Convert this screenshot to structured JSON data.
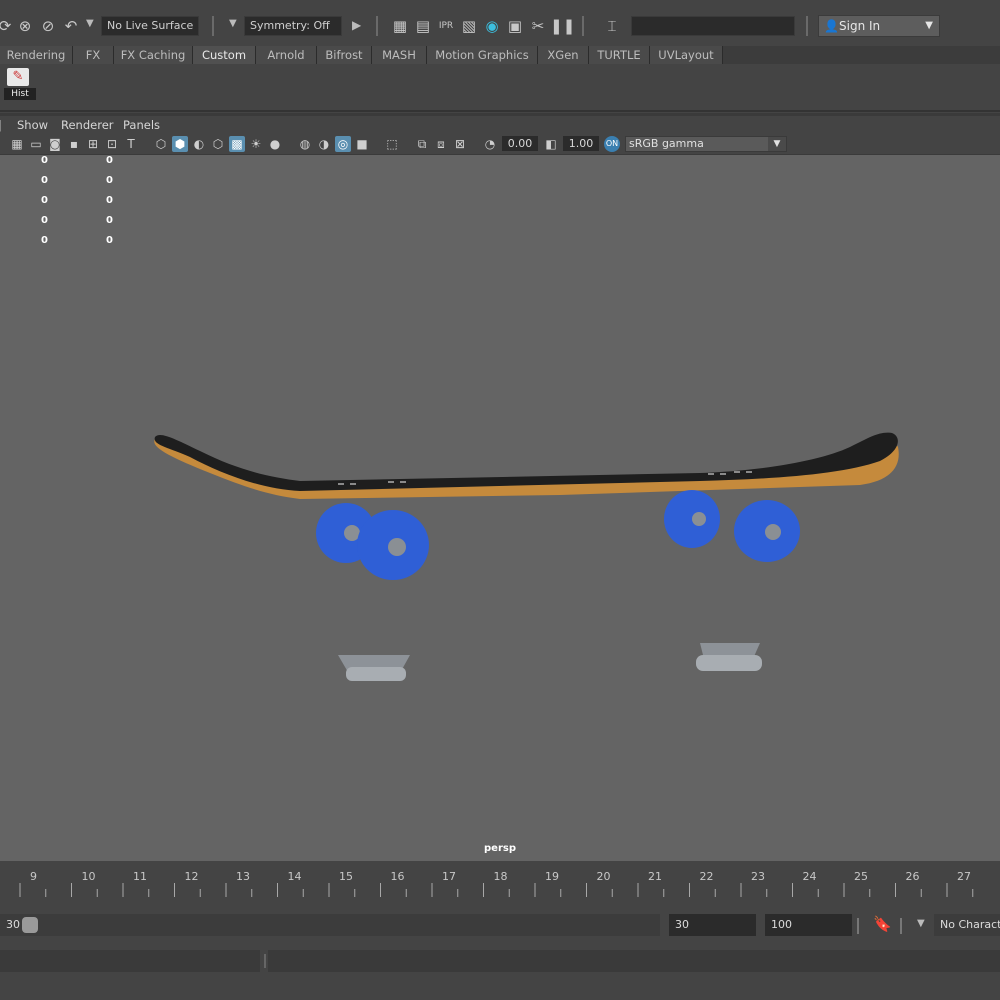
{
  "status_line": {
    "live_surface": "No Live Surface",
    "symmetry": "Symmetry: Off",
    "sign_in": "Sign In",
    "search_value": ""
  },
  "shelf_tabs": [
    "Rendering",
    "FX",
    "FX Caching",
    "Custom",
    "Arnold",
    "Bifrost",
    "MASH",
    "Motion Graphics",
    "XGen",
    "TURTLE",
    "UVLayout"
  ],
  "active_tab": "Custom",
  "shelf": {
    "hist_label": "Hist"
  },
  "panel_menu": [
    "Show",
    "Renderer",
    "Panels"
  ],
  "panel_toolbar": {
    "exposure": "0.00",
    "gamma": "1.00",
    "colorspace": "sRGB gamma"
  },
  "hud": {
    "rows": [
      [
        "0",
        "0"
      ],
      [
        "0",
        "0"
      ],
      [
        "0",
        "0"
      ],
      [
        "0",
        "0"
      ],
      [
        "0",
        "0"
      ]
    ]
  },
  "viewport": {
    "camera": "persp"
  },
  "time_slider": {
    "ticks": [
      "9",
      "10",
      "11",
      "12",
      "13",
      "14",
      "15",
      "16",
      "17",
      "18",
      "19",
      "20",
      "21",
      "22",
      "23",
      "24",
      "25",
      "26",
      "27"
    ]
  },
  "range_slider": {
    "start_value": "30",
    "end_value": "30",
    "anim_end": "100",
    "character_set": "No Character Set"
  },
  "colors": {
    "wheel": "#2f5fd6",
    "deck_wood": "#c58a3c",
    "grip": "#1e1e1e",
    "truck": "#9aa0a6"
  }
}
